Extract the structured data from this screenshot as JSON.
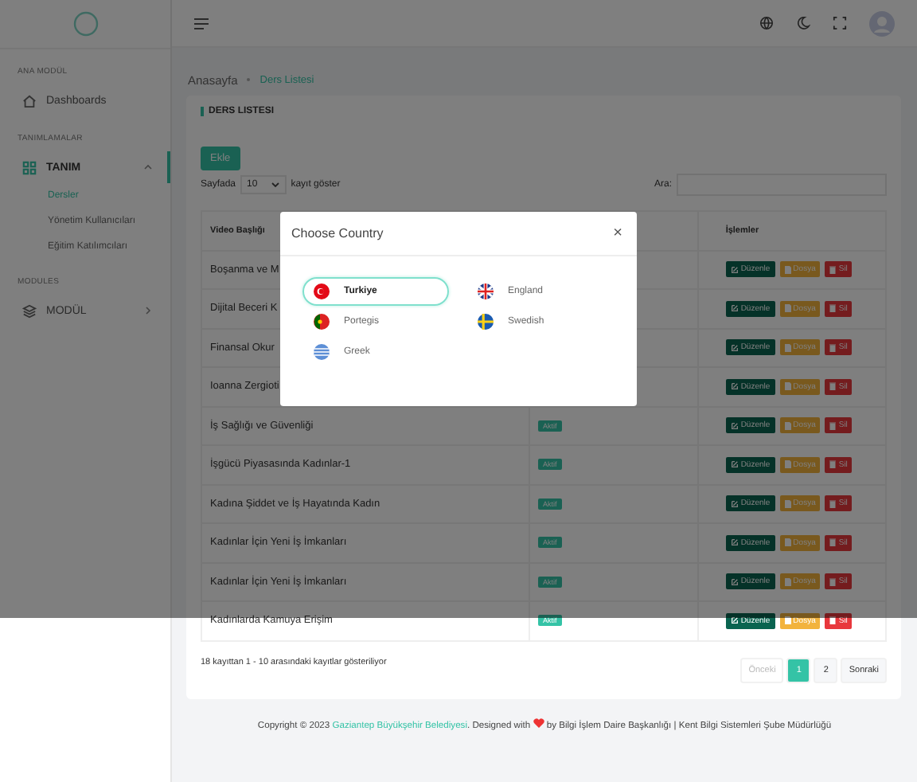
{
  "sidebar": {
    "sections": [
      {
        "title": "ANA MODÜL",
        "items": [
          {
            "label": "Dashboards",
            "selected": false
          }
        ]
      },
      {
        "title": "TANIMLAMALAR",
        "items": [
          {
            "label": "TANIM",
            "selected": true,
            "expanded": true,
            "children": [
              {
                "label": "Dersler",
                "selected": true
              },
              {
                "label": "Yönetim Kullanıcıları",
                "selected": false
              },
              {
                "label": "Eğitim Katılımcıları",
                "selected": false
              }
            ]
          }
        ]
      },
      {
        "title": "MODULES",
        "items": [
          {
            "label": "MODÜL",
            "selected": false,
            "expanded": false
          }
        ]
      }
    ]
  },
  "breadcrumb": [
    "Anasayfa",
    "Ders Listesi"
  ],
  "card": {
    "title": "DERS LISTESI",
    "add_button": "Ekle",
    "page_size_prefix": "Sayfada",
    "page_size": "10",
    "page_size_suffix": "kayıt göster",
    "search_label": "Ara:"
  },
  "table": {
    "columns": [
      "Video Başlığı",
      "İşlemler"
    ],
    "rows": [
      {
        "title": "Boşanma ve M",
        "actions": [
          "Düzenle",
          "Dosya",
          "Sil"
        ]
      },
      {
        "title": "Dijital Beceri K",
        "actions": [
          "Düzenle",
          "Dosya",
          "Sil"
        ]
      },
      {
        "title": "Finansal Okur",
        "actions": [
          "Düzenle",
          "Dosya",
          "Sil"
        ]
      },
      {
        "title": "Ioanna Zergioti",
        "actions": [
          "Düzenle",
          "Dosya",
          "Sil"
        ]
      },
      {
        "title": "İş Sağlığı ve Güvenliği",
        "badge": "Aktif",
        "actions": [
          "Düzenle",
          "Dosya",
          "Sil"
        ]
      },
      {
        "title": "İşgücü Piyasasında Kadınlar-1",
        "badge": "Aktif",
        "actions": [
          "Düzenle",
          "Dosya",
          "Sil"
        ]
      },
      {
        "title": "Kadına Şiddet ve İş Hayatında Kadın",
        "badge": "Aktif",
        "actions": [
          "Düzenle",
          "Dosya",
          "Sil"
        ]
      },
      {
        "title": "Kadınlar İçin Yeni İş İmkanları",
        "badge": "Aktif",
        "actions": [
          "Düzenle",
          "Dosya",
          "Sil"
        ]
      },
      {
        "title": "Kadınlar İçin Yeni İş İmkanları",
        "badge": "Aktif",
        "actions": [
          "Düzenle",
          "Dosya",
          "Sil"
        ]
      },
      {
        "title": "Kadınlarda Kamuya Erişim",
        "badge": "Aktif",
        "actions": [
          "Düzenle",
          "Dosya",
          "Sil"
        ]
      }
    ]
  },
  "info": "18 kayıttan 1 - 10 arasındaki kayıtlar gösteriliyor",
  "pagination": [
    {
      "label": "Önceki",
      "disabled": true,
      "selected": false
    },
    {
      "label": "1",
      "disabled": false,
      "selected": true
    },
    {
      "label": "2",
      "disabled": false,
      "selected": false
    },
    {
      "label": "Sonraki",
      "disabled": false,
      "selected": false
    }
  ],
  "footer": {
    "prefix": "Copyright © 2023",
    "link": "Gaziantep Büyükşehir Belediyesi",
    "middle": ". Designed with",
    "suffix": "by Bilgi İşlem Daire Başkanlığı | Kent Bilgi Sistemleri Şube Müdürlüğü"
  },
  "modal": {
    "title": "Choose Country",
    "close": "×",
    "countries": [
      {
        "label": "Turkiye",
        "selected": true
      },
      {
        "label": "England",
        "selected": false
      },
      {
        "label": "Portegis",
        "selected": false
      },
      {
        "label": "Swedish",
        "selected": false
      },
      {
        "label": "Greek",
        "selected": false
      }
    ]
  }
}
